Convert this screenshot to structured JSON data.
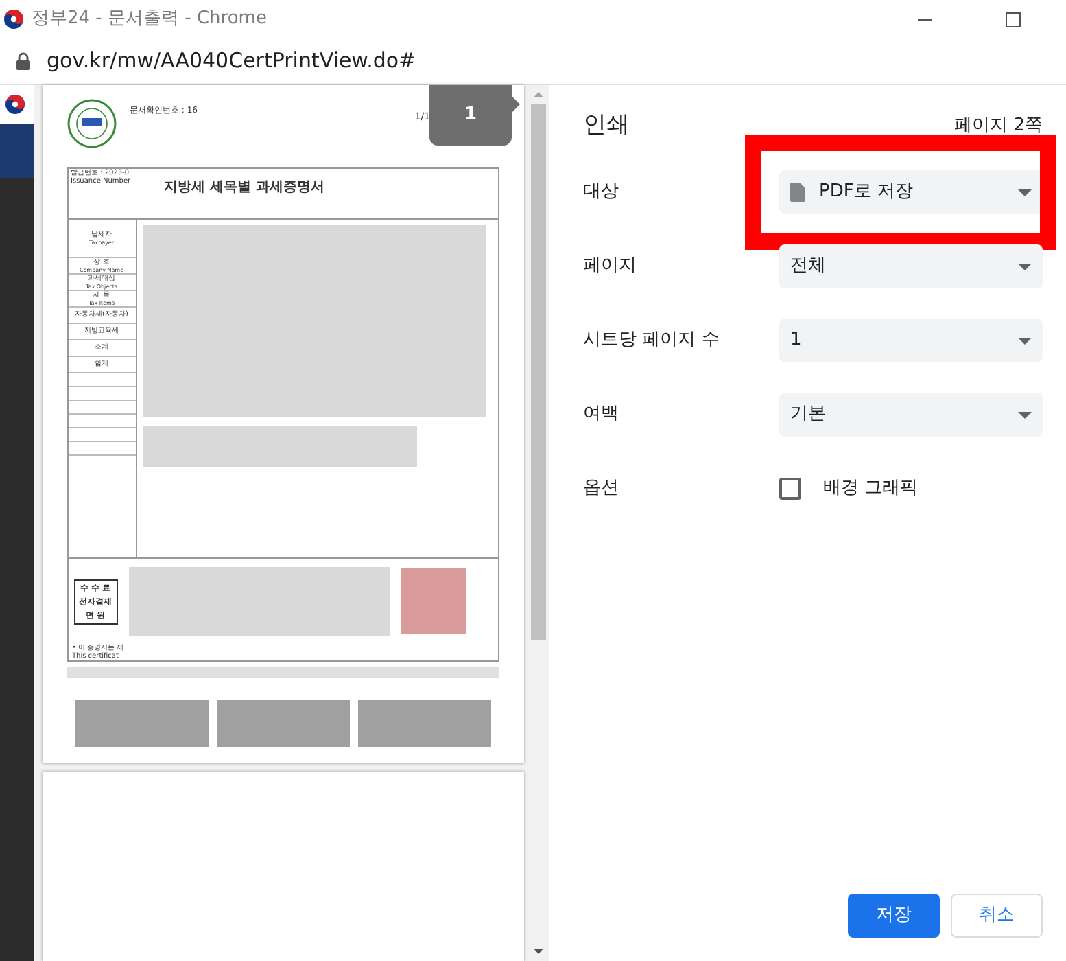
{
  "window": {
    "title": "정부24 - 문서출력 - Chrome"
  },
  "address_bar": {
    "url": "gov.kr/mw/AA040CertPrintView.do#"
  },
  "preview": {
    "page_badge": "1",
    "document": {
      "confirm_no": "문서확인번호 : 16",
      "page_of": "1/1",
      "issue_no": "발급번호 : 2023-0",
      "issue_no_en": "Issuance Number",
      "title": "지방세 세목별 과세증명서",
      "row_labels": [
        {
          "ko": "납세자",
          "en": "Taxpayer"
        },
        {
          "ko": "상 호",
          "en": "Company Name"
        },
        {
          "ko": "과세대상",
          "en": "Tax Objects"
        },
        {
          "ko": "세 목",
          "en": "Tax Items"
        },
        {
          "ko": "자동차세(자동차)"
        },
        {
          "ko": "지방교육세"
        },
        {
          "ko": "소계"
        },
        {
          "ko": "합계"
        }
      ],
      "fee_box": [
        "수 수 료",
        "전자결제",
        "면 원"
      ],
      "notice": [
        "• 이 증명서는 제",
        "This certificat"
      ]
    }
  },
  "print_settings": {
    "title": "인쇄",
    "page_count": "페이지 2쪽",
    "rows": [
      {
        "kind": "destination",
        "label": "대상",
        "value": "PDF로 저장",
        "highlighted": true
      },
      {
        "kind": "select",
        "label": "페이지",
        "value": "전체",
        "highlighted": false
      },
      {
        "kind": "select",
        "label": "시트당 페이지 수",
        "value": "1",
        "highlighted": false
      },
      {
        "kind": "select",
        "label": "여백",
        "value": "기본",
        "highlighted": false
      },
      {
        "kind": "checkbox",
        "label": "옵션",
        "option": "배경 그래픽",
        "checked": false
      }
    ]
  },
  "buttons": [
    {
      "label": "저장",
      "primary": true
    },
    {
      "label": "취소",
      "primary": false
    }
  ]
}
